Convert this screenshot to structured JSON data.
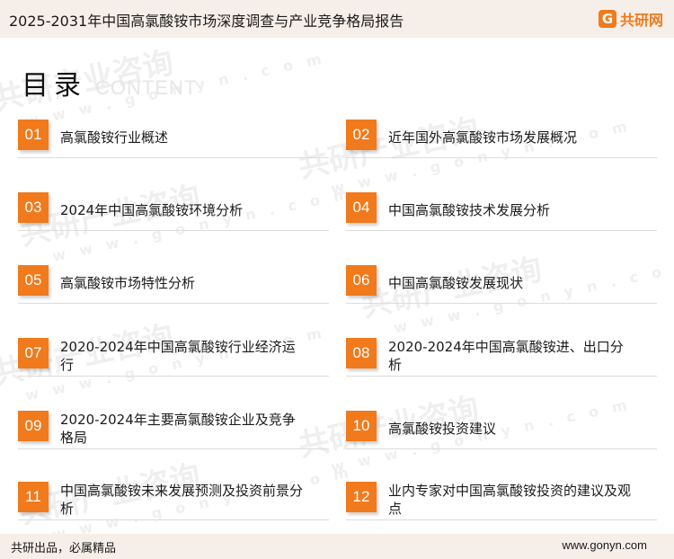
{
  "header": {
    "title": "2025-2031年中国高氯酸铵市场深度调查与产业竞争格局报告",
    "brand_logo_letter": "G",
    "brand_name": "共研网"
  },
  "heading": {
    "main": "目录",
    "sub": "CONTENT"
  },
  "watermark": {
    "text": "共研产业咨询",
    "domain": "w w w . g o n y n . c o m"
  },
  "toc": [
    {
      "num": "01",
      "label": "高氯酸铵行业概述"
    },
    {
      "num": "02",
      "label": "近年国外高氯酸铵市场发展概况"
    },
    {
      "num": "03",
      "label": "2024年中国高氯酸铵环境分析"
    },
    {
      "num": "04",
      "label": "中国高氯酸铵技术发展分析"
    },
    {
      "num": "05",
      "label": "高氯酸铵市场特性分析"
    },
    {
      "num": "06",
      "label": "中国高氯酸铵发展现状"
    },
    {
      "num": "07",
      "label": "2020-2024年中国高氯酸铵行业经济运行"
    },
    {
      "num": "08",
      "label": "2020-2024年中国高氯酸铵进、出口分析"
    },
    {
      "num": "09",
      "label": "2020-2024年主要高氯酸铵企业及竞争格局"
    },
    {
      "num": "10",
      "label": "高氯酸铵投资建议"
    },
    {
      "num": "11",
      "label": "中国高氯酸铵未来发展预测及投资前景分析"
    },
    {
      "num": "12",
      "label": "业内专家对中国高氯酸铵投资的建议及观点"
    }
  ],
  "footer": {
    "slogan": "共研出品，必属精品",
    "url": "www.gonyn.com"
  },
  "colors": {
    "accent": "#f07a1c",
    "bar_background": "#f6eee8"
  }
}
